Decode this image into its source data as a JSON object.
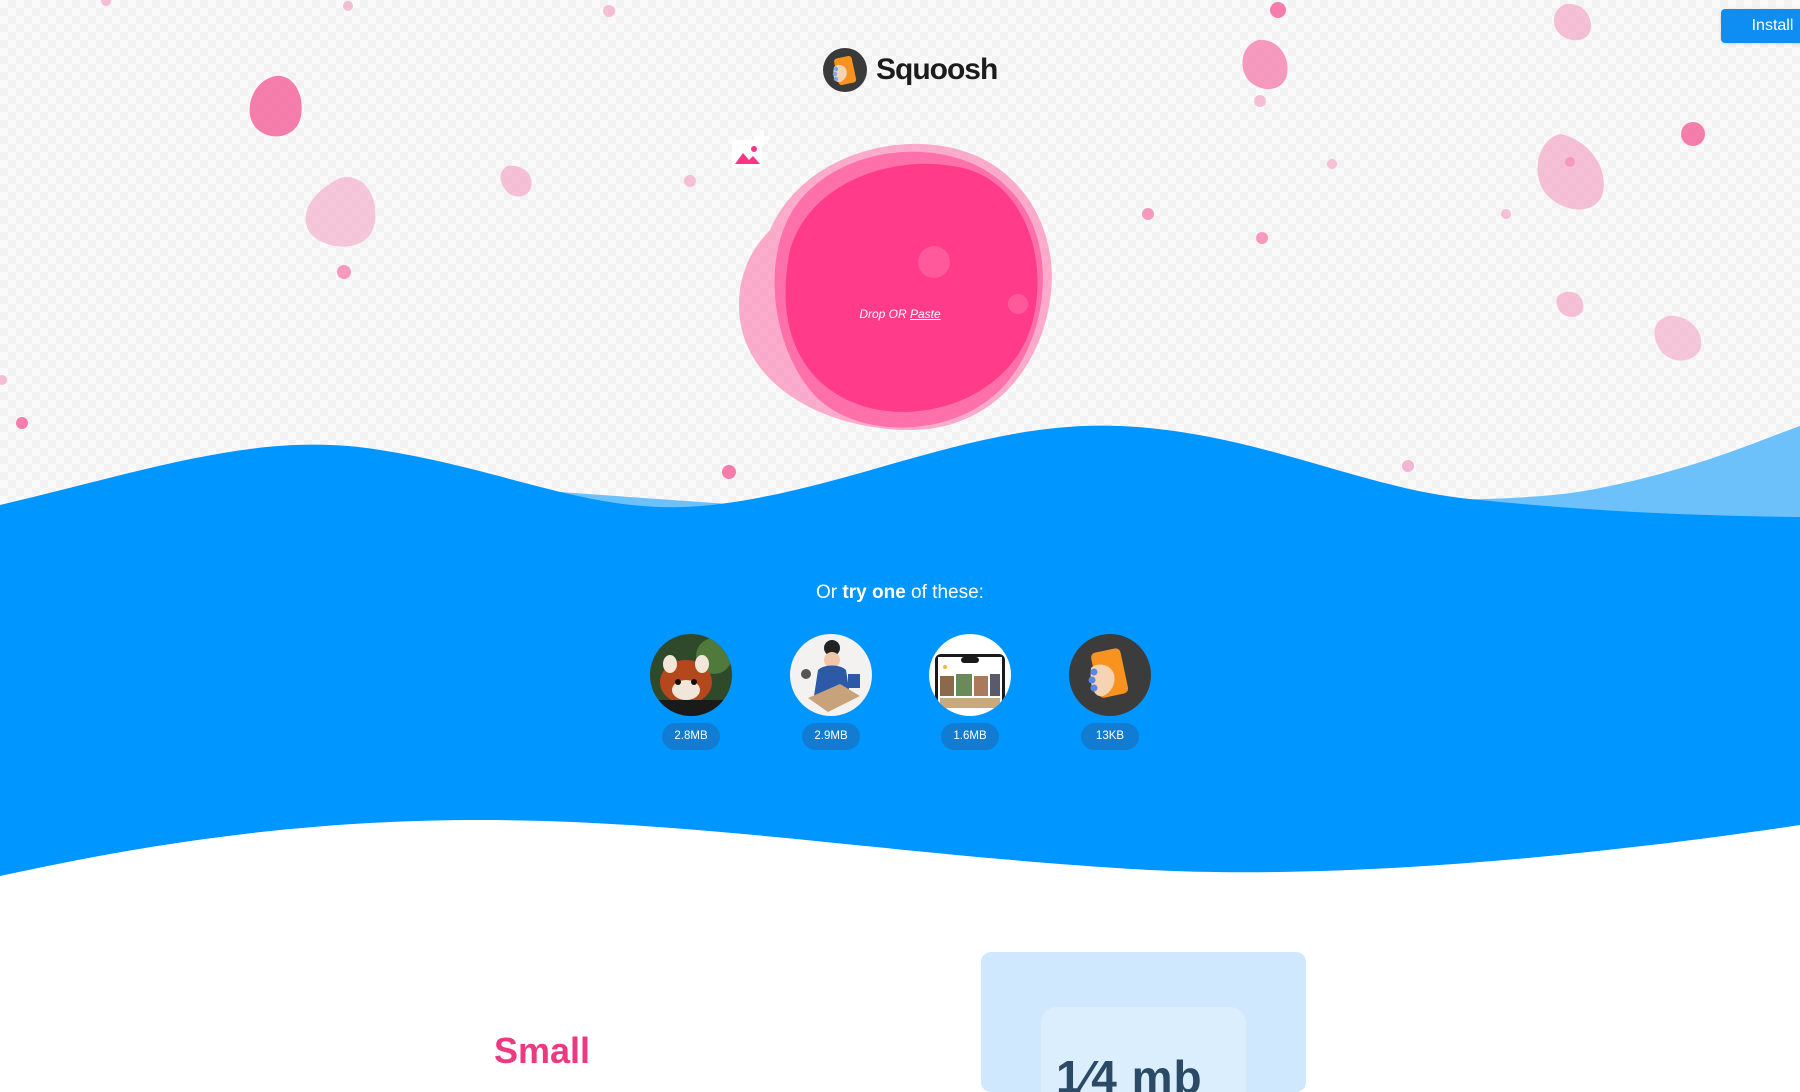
{
  "header": {
    "install_label": "Install"
  },
  "logo": {
    "text": "Squoosh"
  },
  "drop_zone": {
    "drop_text": "Drop OR ",
    "paste_label": "Paste"
  },
  "demos": {
    "heading_before": "Or ",
    "heading_bold": "try one",
    "heading_after": " of these:",
    "items": [
      {
        "size": "2.8MB",
        "image": "red-panda-photo"
      },
      {
        "size": "2.9MB",
        "image": "artist-illustration"
      },
      {
        "size": "1.6MB",
        "image": "phone-screenshot"
      },
      {
        "size": "13KB",
        "image": "squoosh-logo"
      }
    ]
  },
  "feature": {
    "title": "Small",
    "card_text": "1⁄4 mb"
  },
  "colors": {
    "accent_pink": "#ff3385",
    "blob_pink": "#f9a0c4",
    "wave_blue": "#0096ff",
    "wave_light_blue": "#6cc1fb",
    "install_blue": "#0e8ef3",
    "title_pink": "#ec3982"
  }
}
